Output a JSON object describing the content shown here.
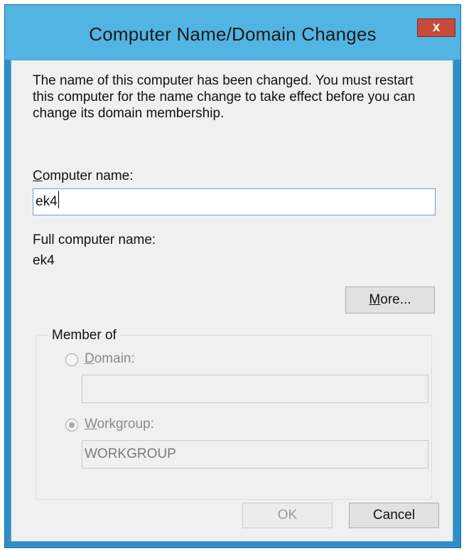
{
  "window": {
    "title": "Computer Name/Domain Changes",
    "close_glyph": "x"
  },
  "intro_text": "The name of this computer has been changed.  You must restart this computer for the name change to take effect before you can change its domain membership.",
  "computer_name": {
    "label_accel": "C",
    "label_rest": "omputer name:",
    "value": "ek4"
  },
  "full_computer_name": {
    "label": "Full computer name:",
    "value": "ek4"
  },
  "more_button": {
    "accel": "M",
    "rest": "ore..."
  },
  "member_of": {
    "legend": "Member of",
    "domain": {
      "label_accel": "D",
      "label_rest": "omain:",
      "value": "",
      "selected": false
    },
    "workgroup": {
      "label_accel": "W",
      "label_rest": "orkgroup:",
      "value": "WORKGROUP",
      "selected": true
    }
  },
  "buttons": {
    "ok": "OK",
    "cancel": "Cancel"
  },
  "colors": {
    "titlebar": "#52b4e2",
    "frame": "#2e8ec8",
    "close_button": "#c74a3a",
    "client_bg": "#f0f0f0"
  }
}
